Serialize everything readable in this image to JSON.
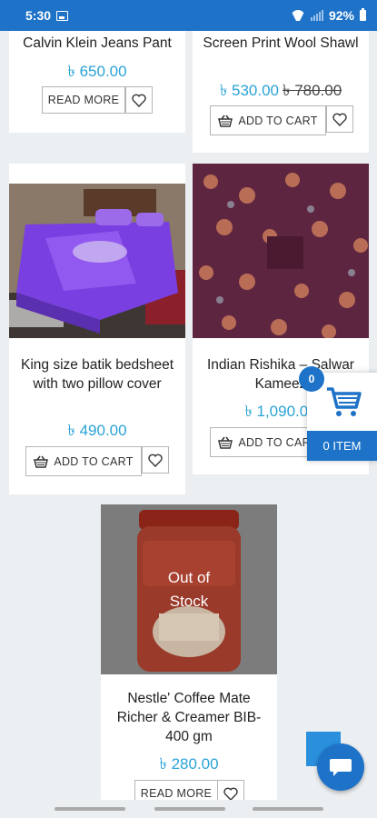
{
  "status_bar": {
    "time": "5:30",
    "battery": "92%"
  },
  "currency": "৳",
  "products": [
    {
      "title": "Calvin Klein Jeans Pant",
      "price": "৳ 650.00",
      "old_price": "",
      "button": "READ MORE"
    },
    {
      "title": "Screen Print Wool Shawl",
      "price": "৳ 530.00",
      "old_price": "৳ 780.00",
      "button": "ADD TO CART"
    },
    {
      "title": "King size batik bedsheet with two pillow cover",
      "price": "৳ 490.00",
      "old_price": "",
      "button": "ADD TO CART"
    },
    {
      "title": "Indian Rishika – Salwar Kameez",
      "price": "৳ 1,090.00",
      "old_price": "",
      "button": "ADD TO CART"
    },
    {
      "title": "Nestle' Coffee Mate Richer & Creamer BIB-400 gm",
      "price": "৳ 280.00",
      "old_price": "",
      "button": "READ MORE",
      "overlay": "Out of Stock"
    }
  ],
  "cart": {
    "count": "0",
    "label": "0 ITEM"
  },
  "colors": {
    "brand": "#1e73c9",
    "price": "#2aa3d6"
  },
  "icons": [
    "image-icon",
    "wifi-icon",
    "signal-icon",
    "battery-icon",
    "basket-icon",
    "heart-icon",
    "cart-icon",
    "chat-icon"
  ]
}
